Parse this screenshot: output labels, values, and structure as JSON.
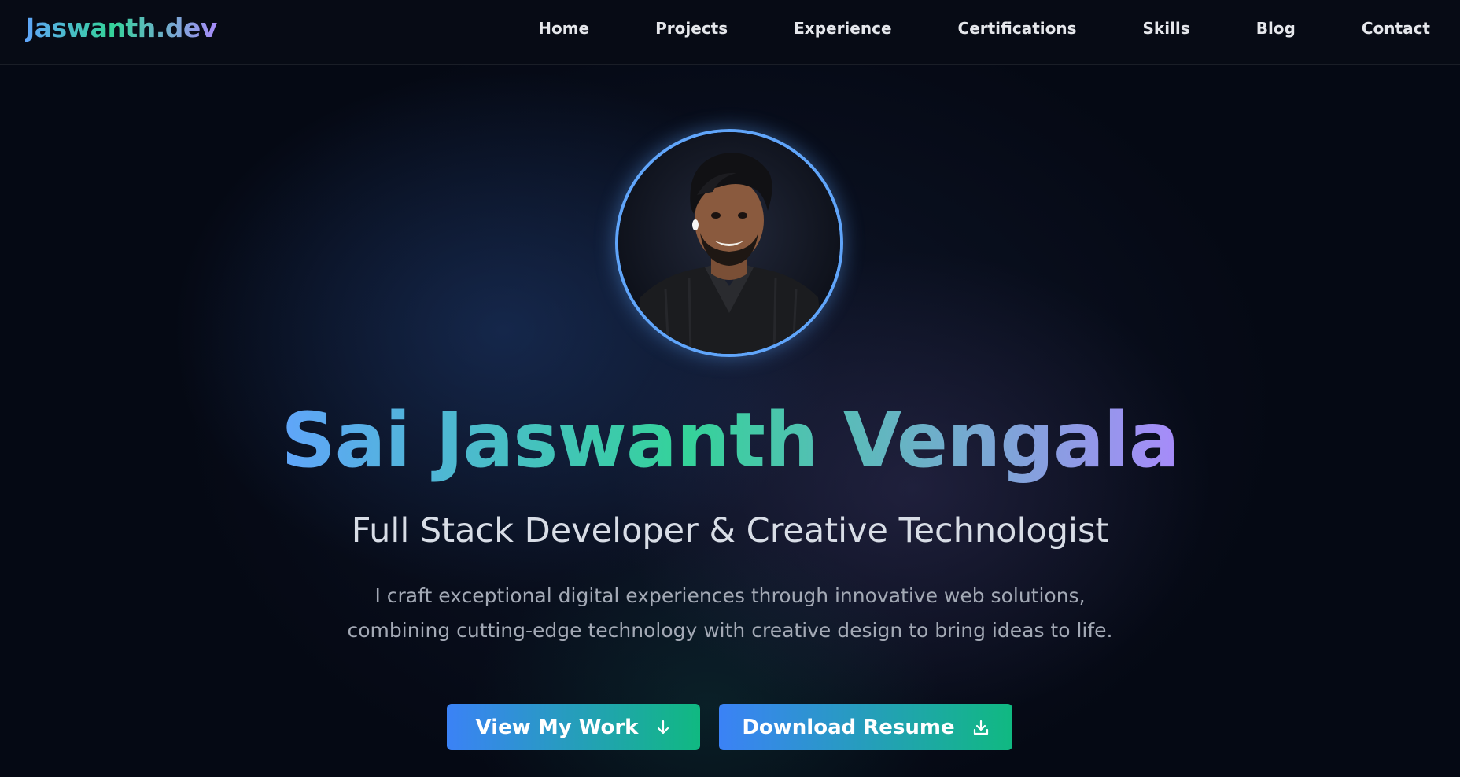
{
  "brand": "Jaswanth.dev",
  "nav": {
    "items": [
      {
        "label": "Home"
      },
      {
        "label": "Projects"
      },
      {
        "label": "Experience"
      },
      {
        "label": "Certifications"
      },
      {
        "label": "Skills"
      },
      {
        "label": "Blog"
      },
      {
        "label": "Contact"
      }
    ]
  },
  "hero": {
    "avatar_alt": "profile-photo",
    "name": "Sai Jaswanth Vengala",
    "subtitle": "Full Stack Developer & Creative Technologist",
    "description": "I craft exceptional digital experiences through innovative web solutions, combining cutting-edge technology with creative design to bring ideas to life.",
    "buttons": {
      "primary": {
        "label": "View My Work",
        "icon": "arrow-down-icon"
      },
      "secondary": {
        "label": "Download Resume",
        "icon": "download-icon"
      }
    }
  },
  "colors": {
    "background": "#050914",
    "accent_blue": "#60a5fa",
    "accent_green": "#34d399",
    "accent_purple": "#a78bfa",
    "button_start": "#3b82f6",
    "button_end": "#10b981"
  }
}
